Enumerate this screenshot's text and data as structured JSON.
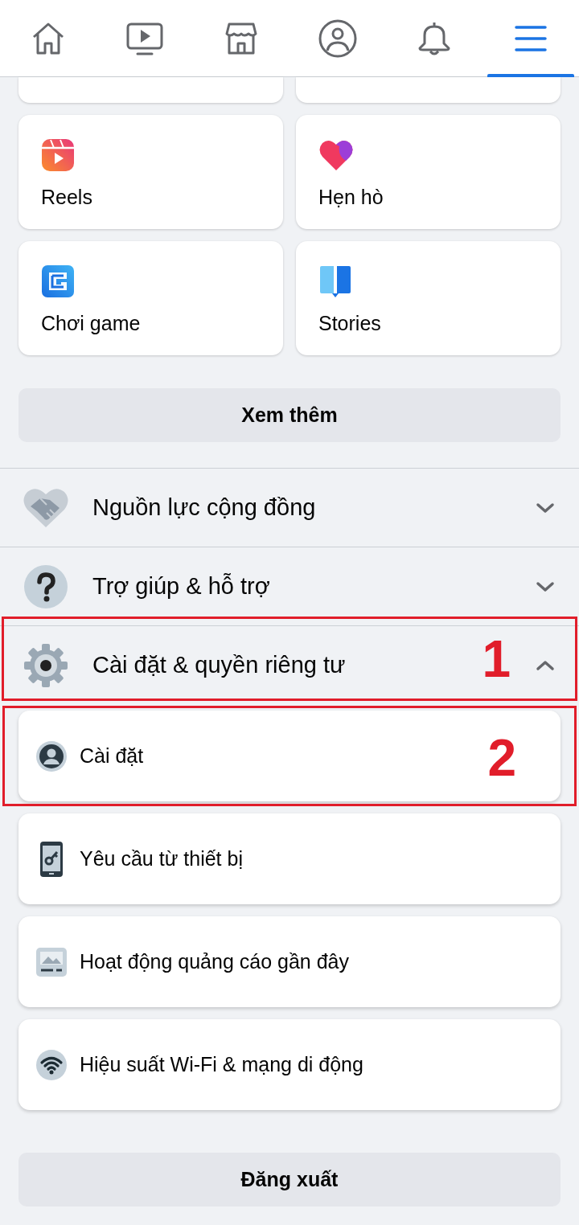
{
  "nav": {
    "tabs": [
      {
        "kind": "home",
        "selected": false
      },
      {
        "kind": "video",
        "selected": false
      },
      {
        "kind": "store",
        "selected": false
      },
      {
        "kind": "profile",
        "selected": false
      },
      {
        "kind": "bell",
        "selected": false
      },
      {
        "kind": "menu",
        "selected": true
      }
    ]
  },
  "shortcuts": [
    {
      "kind": "reels",
      "label": "Reels"
    },
    {
      "kind": "dating",
      "label": "Hẹn hò"
    },
    {
      "kind": "gaming",
      "label": "Chơi game"
    },
    {
      "kind": "stories",
      "label": "Stories"
    }
  ],
  "see_more": "Xem thêm",
  "sections": [
    {
      "kind": "community",
      "label": "Nguồn lực cộng đồng",
      "expanded": false
    },
    {
      "kind": "help",
      "label": "Trợ giúp & hỗ trợ",
      "expanded": false
    },
    {
      "kind": "settings",
      "label": "Cài đặt & quyền riêng tư",
      "expanded": true,
      "annotation": "1"
    }
  ],
  "settings_items": [
    {
      "kind": "profile",
      "label": "Cài đặt",
      "annotation": "2"
    },
    {
      "kind": "device",
      "label": "Yêu cầu từ thiết bị"
    },
    {
      "kind": "ads",
      "label": "Hoạt động quảng cáo gần đây"
    },
    {
      "kind": "wifi",
      "label": "Hiệu suất Wi-Fi & mạng di động"
    }
  ],
  "logout": "Đăng xuất"
}
